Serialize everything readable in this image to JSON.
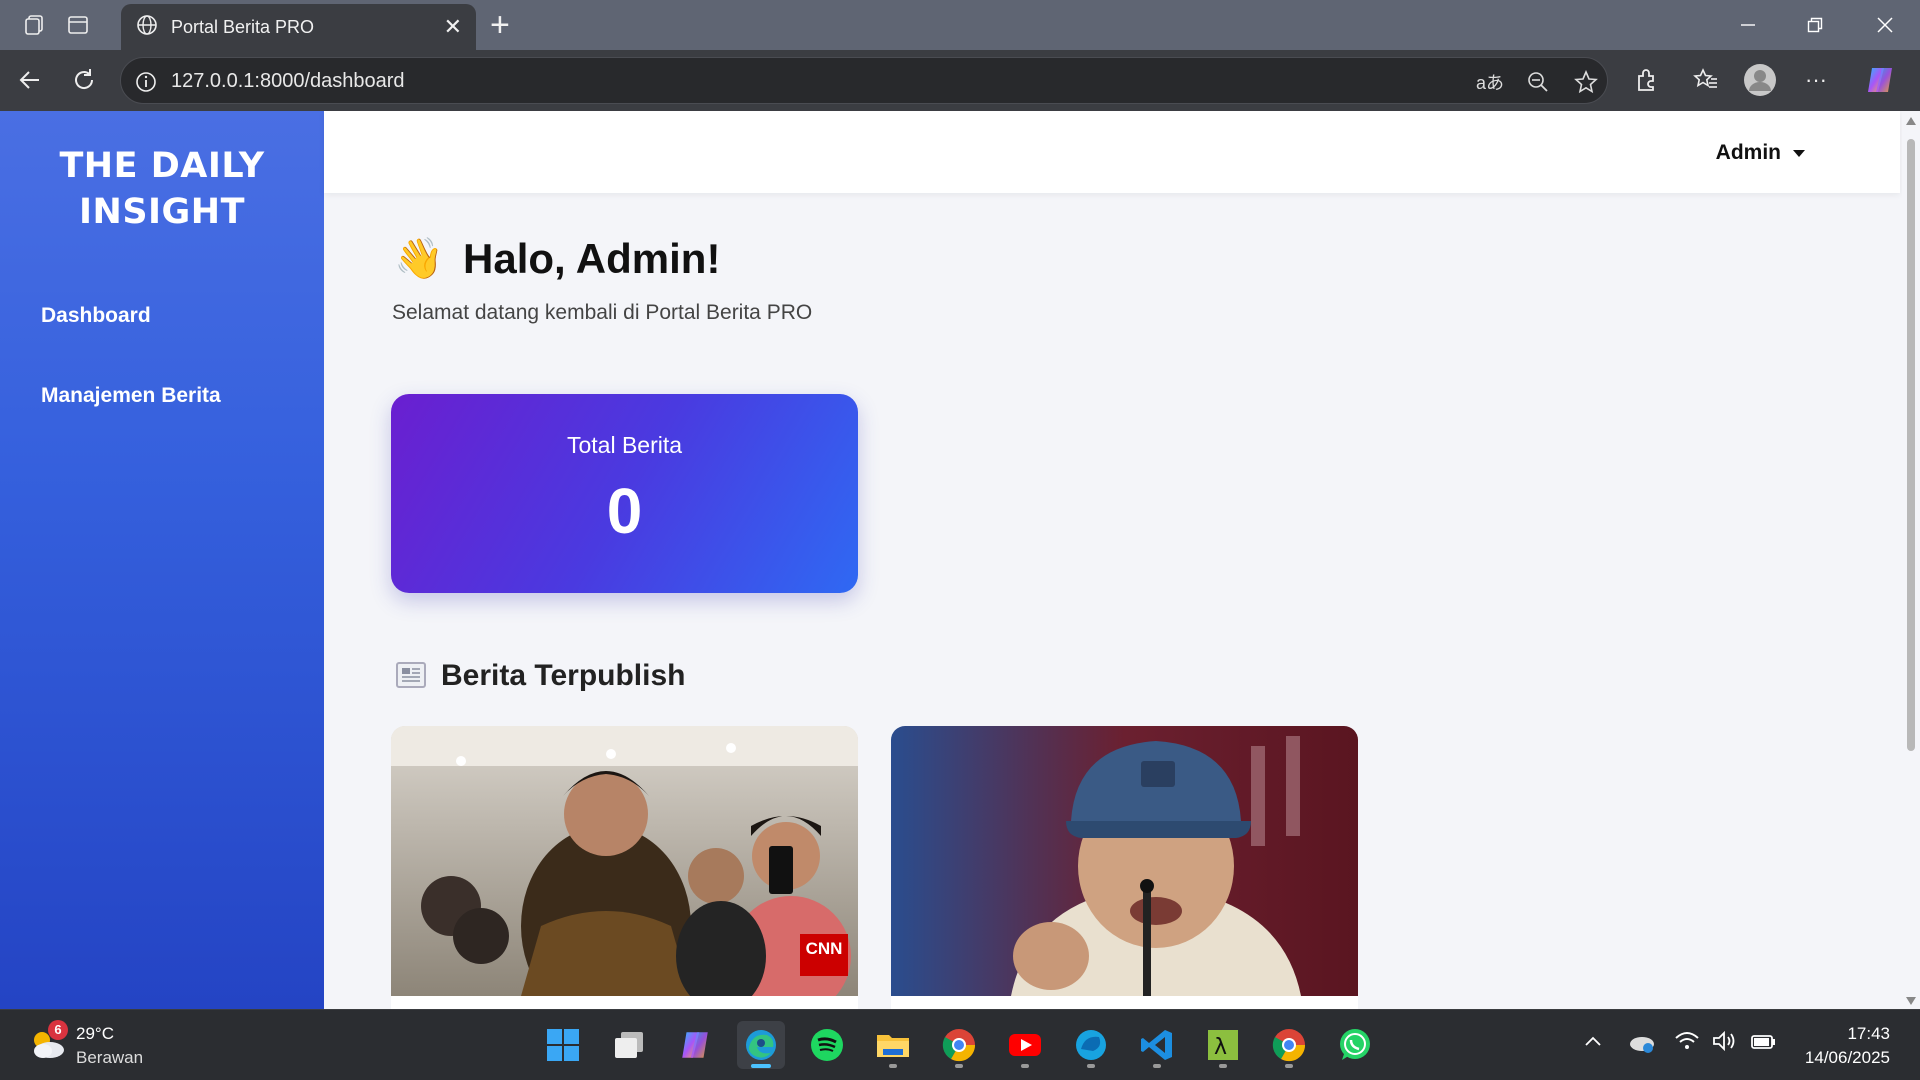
{
  "browser": {
    "tab_title": "Portal Berita PRO",
    "url": "127.0.0.1:8000/dashboard"
  },
  "sidebar": {
    "brand_line1": "THE DAILY",
    "brand_line2": "INSIGHT",
    "items": [
      {
        "label": "Dashboard"
      },
      {
        "label": "Manajemen Berita"
      }
    ]
  },
  "topnav": {
    "user_label": "Admin"
  },
  "main": {
    "greeting_emoji": "👋",
    "greeting": "Halo, Admin!",
    "subtitle": "Selamat datang kembali di Portal Berita PRO",
    "stat": {
      "label": "Total Berita",
      "value": "0"
    },
    "section_title": "Berita Terpublish",
    "news_cards": [
      {
        "image_badge": "CNN"
      },
      {
        "image_badge": ""
      }
    ]
  },
  "taskbar": {
    "weather_badge": "6",
    "temperature": "29°C",
    "weather": "Berawan",
    "time": "17:43",
    "date": "14/06/2025",
    "apps": [
      "start",
      "task-view",
      "copilot",
      "edge",
      "spotify",
      "file-explorer",
      "chrome",
      "youtube",
      "edge-dev",
      "vscode",
      "maple",
      "chrome-profile",
      "whatsapp"
    ]
  },
  "colors": {
    "sidebar_top": "#4a6fe3",
    "sidebar_bottom": "#2444c4",
    "card_gradient_start": "#6a1fd0",
    "card_gradient_end": "#2f69f3",
    "page_bg": "#f4f5f9"
  }
}
